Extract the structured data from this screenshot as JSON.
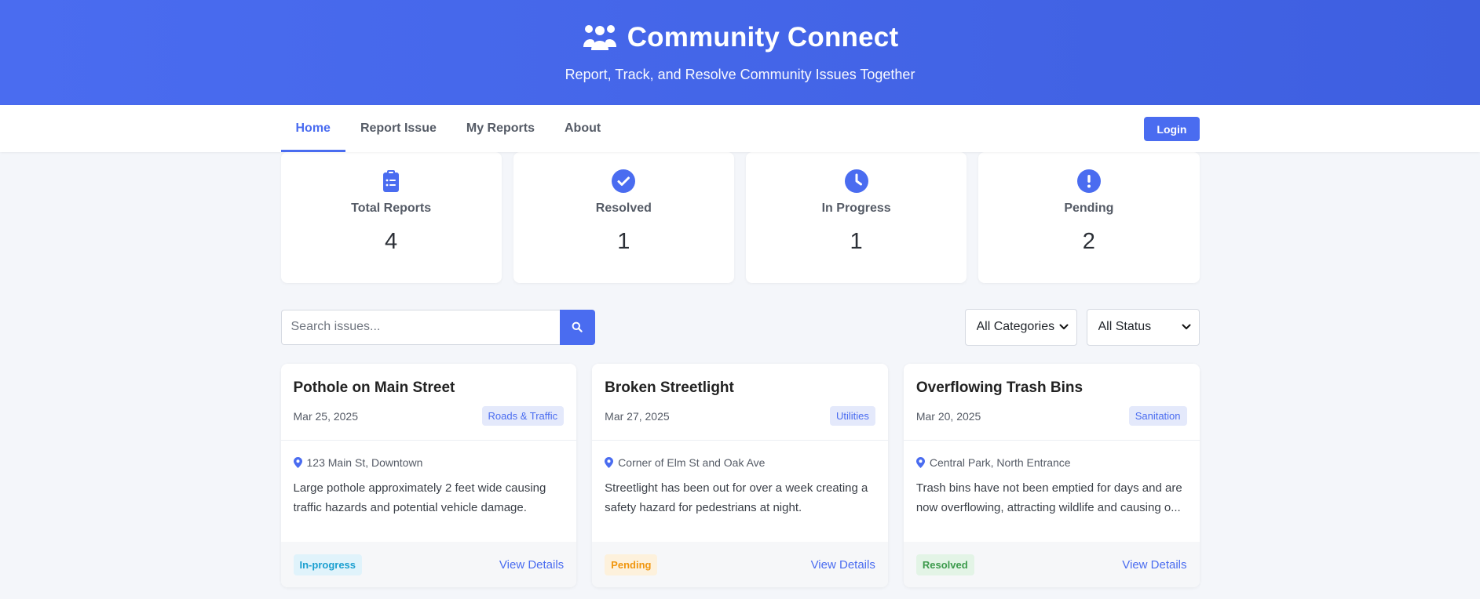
{
  "header": {
    "brand_icon": "people-group-icon",
    "title": "Community Connect",
    "tagline": "Report, Track, and Resolve Community Issues Together"
  },
  "nav": {
    "tabs": [
      {
        "label": "Home",
        "active": true
      },
      {
        "label": "Report Issue",
        "active": false
      },
      {
        "label": "My Reports",
        "active": false
      },
      {
        "label": "About",
        "active": false
      }
    ],
    "login_label": "Login"
  },
  "stats": [
    {
      "icon": "clipboard-list-icon",
      "label": "Total Reports",
      "value": "4"
    },
    {
      "icon": "check-circle-icon",
      "label": "Resolved",
      "value": "1"
    },
    {
      "icon": "clock-icon",
      "label": "In Progress",
      "value": "1"
    },
    {
      "icon": "exclamation-circle-icon",
      "label": "Pending",
      "value": "2"
    }
  ],
  "toolbar": {
    "search_placeholder": "Search issues...",
    "search_icon": "search-icon",
    "category_filter": "All Categories",
    "status_filter": "All Status"
  },
  "issues": [
    {
      "title": "Pothole on Main Street",
      "date": "Mar 25, 2025",
      "category": "Roads & Traffic",
      "location": "123 Main St, Downtown",
      "description": "Large pothole approximately 2 feet wide causing traffic hazards and potential vehicle damage.",
      "status": "In-progress",
      "link": "View Details"
    },
    {
      "title": "Broken Streetlight",
      "date": "Mar 27, 2025",
      "category": "Utilities",
      "location": "Corner of Elm St and Oak Ave",
      "description": "Streetlight has been out for over a week creating a safety hazard for pedestrians at night.",
      "status": "Pending",
      "link": "View Details"
    },
    {
      "title": "Overflowing Trash Bins",
      "date": "Mar 20, 2025",
      "category": "Sanitation",
      "location": "Central Park, North Entrance",
      "description": "Trash bins have not been emptied for days and are now overflowing, attracting wildlife and causing o...",
      "status": "Resolved",
      "link": "View Details"
    }
  ],
  "colors": {
    "primary": "#4a6cf0",
    "in_progress": "#1b9fd0",
    "pending": "#f0960f",
    "resolved": "#3c9a4c"
  }
}
